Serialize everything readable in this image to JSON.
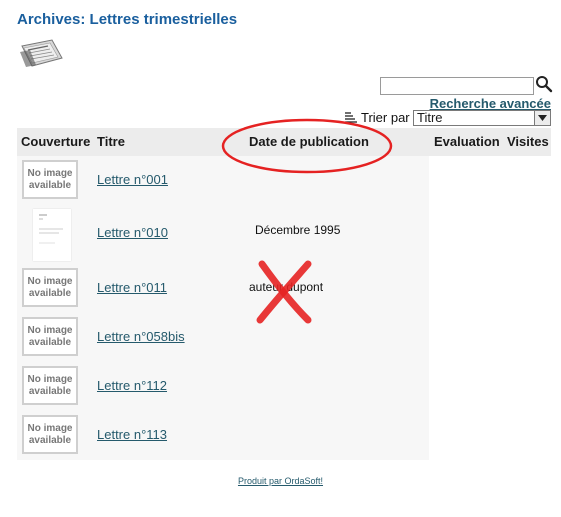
{
  "page": {
    "title": "Archives: Lettres trimestrielles"
  },
  "search": {
    "value": "",
    "placeholder": "",
    "advanced_label": "Recherche avancée"
  },
  "sort": {
    "label": "Trier par",
    "selected": "Titre"
  },
  "table": {
    "headers": {
      "cover": "Couverture",
      "title": "Titre",
      "publication_date": "Date de publication",
      "rating": "Evaluation",
      "visits": "Visites"
    },
    "no_image_text": "No image available",
    "rows": [
      {
        "cover": "no-image",
        "title": "Lettre n°001",
        "publication": ""
      },
      {
        "cover": "thumbnail",
        "title": "Lettre n°010",
        "publication": "Décembre 1995"
      },
      {
        "cover": "no-image",
        "title": "Lettre n°011",
        "publication": "auteur dupont"
      },
      {
        "cover": "no-image",
        "title": "Lettre n°058bis",
        "publication": ""
      },
      {
        "cover": "no-image",
        "title": "Lettre n°112",
        "publication": ""
      },
      {
        "cover": "no-image",
        "title": "Lettre n°113",
        "publication": ""
      }
    ]
  },
  "footer": {
    "credit": "Produit par OrdaSoft!"
  },
  "annotations": {
    "highlight_color": "#e52222",
    "items": [
      "ellipse-around-date-column",
      "cross-over-author-cell"
    ]
  },
  "icons": [
    "newspaper-icon",
    "search-icon",
    "sort-icon",
    "chevron-down-icon"
  ]
}
